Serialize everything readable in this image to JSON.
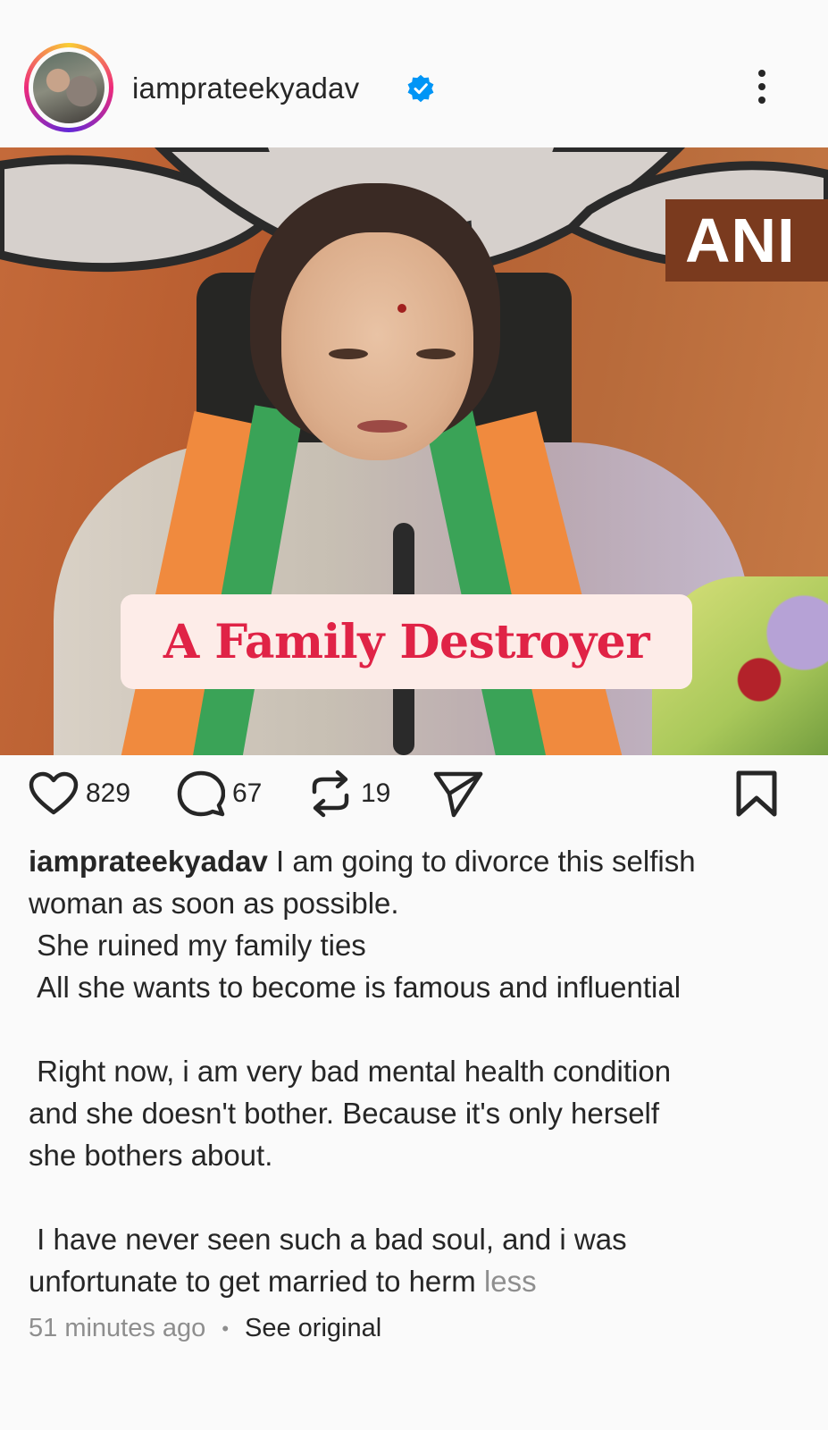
{
  "post": {
    "username": "iamprateekyadav",
    "verified": true,
    "image_overlay": {
      "watermark": "ANI",
      "caption": "A Family Destroyer"
    }
  },
  "actions": {
    "likes": "829",
    "comments": "67",
    "reposts": "19"
  },
  "caption": {
    "username": "iamprateekyadav",
    "line1_rest": " I am going to divorce this selfish",
    "line2": "woman as soon as possible.",
    "line3": " She ruined my family ties",
    "line4": " All she wants to become is famous and influential",
    "line5": " Right now, i am very bad mental health condition",
    "line6": "and she doesn't bother. Because it's only herself",
    "line7": "she bothers about.",
    "line8": " I have never seen such a bad soul, and i was",
    "line9": "unfortunate to get married to herm ",
    "less": "less"
  },
  "meta": {
    "time_ago": "51 minutes ago",
    "separator": "•",
    "see_original": "See original"
  },
  "icons": {
    "verified": "verified-badge-icon",
    "more": "more-vertical-icon",
    "like": "heart-icon",
    "comment": "comment-icon",
    "repost": "repost-icon",
    "share": "send-icon",
    "save": "bookmark-icon"
  },
  "colors": {
    "verified_blue": "#0095f6",
    "caption_red": "#e02346",
    "muted": "#8e8e8e"
  }
}
